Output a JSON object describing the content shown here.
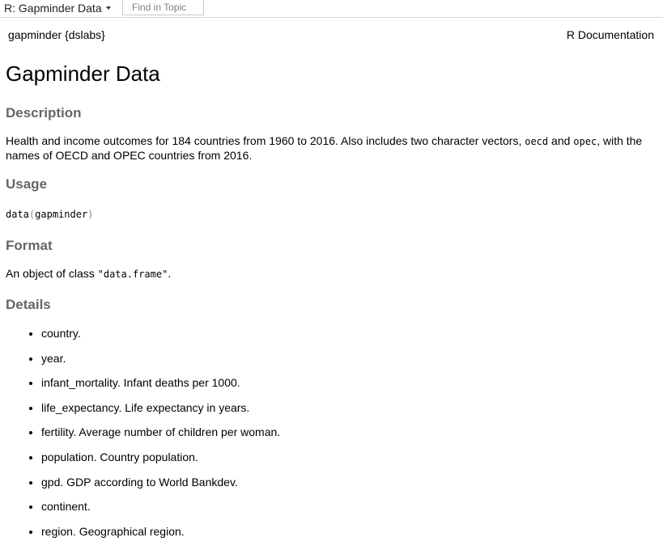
{
  "toolbar": {
    "topic_title": "R: Gapminder Data",
    "find_placeholder": "Find in Topic"
  },
  "header": {
    "package": "gapminder {dslabs}",
    "doc_label": "R Documentation"
  },
  "title": "Gapminder Data",
  "description": {
    "heading": "Description",
    "text_before": "Health and income outcomes for 184 countries from 1960 to 2016. Also includes two character vectors, ",
    "code1": "oecd",
    "text_and": " and ",
    "code2": "opec",
    "text_after": ", with the names of OECD and OPEC countries from 2016."
  },
  "usage": {
    "heading": "Usage",
    "fn": "data",
    "open_paren": "(",
    "arg": "gapminder",
    "close_paren": ")"
  },
  "format": {
    "heading": "Format",
    "text_before": "An object of class ",
    "class_code": "\"data.frame\"",
    "text_after": "."
  },
  "details": {
    "heading": "Details",
    "items": [
      "country.",
      "year.",
      "infant_mortality. Infant deaths per 1000.",
      "life_expectancy. Life expectancy in years.",
      "fertility. Average number of children per woman.",
      "population. Country population.",
      "gpd. GDP according to World Bankdev.",
      "continent.",
      "region. Geographical region."
    ]
  }
}
